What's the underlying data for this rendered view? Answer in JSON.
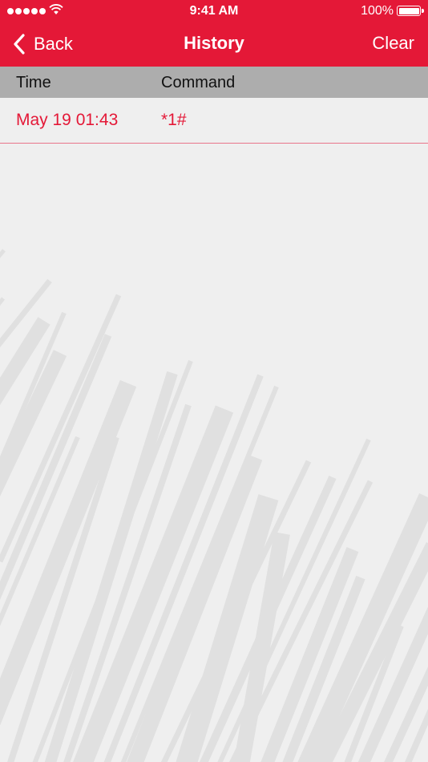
{
  "status_bar": {
    "time": "9:41 AM",
    "battery": "100%",
    "icons": [
      "signal-dots-icon",
      "wifi-icon",
      "battery-icon"
    ]
  },
  "nav": {
    "back_label": "Back",
    "title": "History",
    "clear_label": "Clear"
  },
  "table": {
    "columns": {
      "time": "Time",
      "command": "Command"
    },
    "rows": [
      {
        "time": "May 19 01:43",
        "command": "*1#"
      }
    ]
  },
  "colors": {
    "accent": "#e41837",
    "header_bar": "#adadad",
    "background": "#efefef",
    "stripes": "#e0e0e0"
  }
}
